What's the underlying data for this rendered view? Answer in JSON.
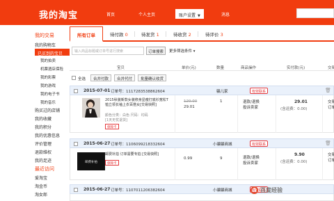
{
  "header": {
    "logo": "我的淘宝",
    "nav": [
      "首页",
      "个人主页",
      "账户设置",
      "消息"
    ]
  },
  "sidebar": {
    "items": [
      {
        "label": "我的交易",
        "kind": "h"
      },
      {
        "label": "我的购物车",
        "kind": ""
      },
      {
        "label": "已买到的宝贝",
        "kind": "act"
      },
      {
        "label": "我的拍卖",
        "kind": "sub"
      },
      {
        "label": "机票酒店保险",
        "kind": "sub"
      },
      {
        "label": "我的彩票",
        "kind": "sub"
      },
      {
        "label": "我的游戏",
        "kind": "sub"
      },
      {
        "label": "我的电子书",
        "kind": "sub"
      },
      {
        "label": "我的音乐",
        "kind": "sub"
      },
      {
        "label": "购买过的店铺",
        "kind": ""
      },
      {
        "label": "我的收藏",
        "kind": ""
      },
      {
        "label": "我的积分",
        "kind": ""
      },
      {
        "label": "我的优惠信息",
        "kind": ""
      },
      {
        "label": "评价管理",
        "kind": ""
      },
      {
        "label": "退款维权",
        "kind": "plus"
      },
      {
        "label": "我的足迹",
        "kind": "plus"
      },
      {
        "label": "最近访问",
        "kind": "h"
      },
      {
        "label": "爱淘宝",
        "kind": ""
      },
      {
        "label": "淘金币",
        "kind": ""
      },
      {
        "label": "淘女郎",
        "kind": ""
      }
    ]
  },
  "tabs": [
    {
      "label": "所有订单",
      "count": ""
    },
    {
      "label": "待付款",
      "count": "0"
    },
    {
      "label": "待发货",
      "count": "1"
    },
    {
      "label": "待收货",
      "count": "2"
    },
    {
      "label": "待评价",
      "count": "3"
    }
  ],
  "filter": {
    "placeholder": "输入商品标题或订单号进行搜索",
    "button": "订单搜索",
    "more": "更多筛选条件"
  },
  "columns": [
    "宝贝",
    "单价(元)",
    "数量",
    "商品操作",
    "实付款(元)",
    "交易状态"
  ],
  "bulk": {
    "select_all": "全选",
    "btn1": "合并付款",
    "btn2": "合并代付",
    "btn3": "批量确认收货"
  },
  "orders": [
    {
      "date": "2015-07-01",
      "order_no": "订单号：1117283538862604",
      "shop": "骗儿家",
      "badge": "有效联系",
      "title": "2015秋装新款女装修身显瘦打底衫宽松T恤立领长袖上衣百搭女[交易快照]",
      "attrs": "颜色分类：白色 尺码：均码",
      "attrs2": "[1天无忧退货]",
      "badge2": "保障卡",
      "price_old": "129.00",
      "price": "29.01",
      "qty": "1",
      "actions": [
        "退款/退换",
        "投诉卖家"
      ],
      "total": "29.01",
      "freight": "(含运费：0.00)",
      "status": [
        "交易已付款",
        "订单详情"
      ]
    },
    {
      "date": "2015-06-27",
      "order_no": "订单号：1106099218332604",
      "shop": "小骗骗商城",
      "badge": "有效联系",
      "title": "邮费补拍 订单需要专拍 [交易快照]",
      "attrs": "",
      "attrs2": "",
      "badge2": "保障卡",
      "thumb_text": "邮费补拍",
      "price_old": "",
      "price": "0.99",
      "qty": "9",
      "actions": [
        "退款/退换",
        "投诉卖家"
      ],
      "total": "9.90",
      "freight": "(含运费：0.00)",
      "status": [
        "交易已付款",
        "订单详情"
      ]
    },
    {
      "date": "2015-06-27",
      "order_no": "订单号：1107011206382604",
      "shop": "小骗骗商城",
      "badge": "有效联系"
    }
  ],
  "watermark": "百度经验"
}
